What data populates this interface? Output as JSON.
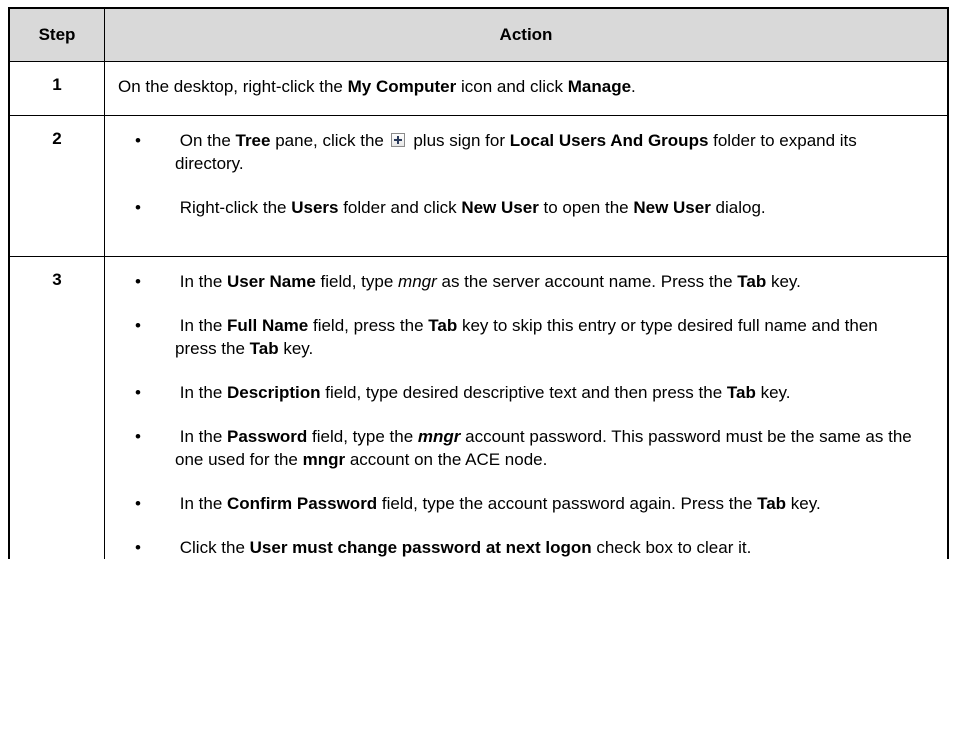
{
  "table": {
    "headers": {
      "step": "Step",
      "action": "Action"
    },
    "row1": {
      "step": "1",
      "t1": "On the desktop, right-click the ",
      "b1": "My Computer",
      "t2": " icon and click ",
      "b2": "Manage",
      "t3": "."
    },
    "row2": {
      "step": "2",
      "bullet1": {
        "t1": "On the ",
        "b1": "Tree",
        "t2": " pane, click the ",
        "t3": " plus sign for ",
        "b2": "Local Users And Groups",
        "t4": " folder to expand its directory."
      },
      "bullet2": {
        "t1": "Right-click the ",
        "b1": "Users",
        "t2": " folder and click ",
        "b2": "New User",
        "t3": " to open the ",
        "b3": "New User",
        "t4": " dialog."
      }
    },
    "row3": {
      "step": "3",
      "bullet1": {
        "t1": "In the ",
        "b1": "User Name",
        "t2": " field, type ",
        "i1": "mngr",
        "t3": " as the server account name. Press the ",
        "b2": "Tab",
        "t4": " key."
      },
      "bullet2": {
        "t1": "In the ",
        "b1": "Full Name",
        "t2": " field, press the ",
        "b2": "Tab",
        "t3": " key to skip this entry or type desired full name and then press the ",
        "b3": "Tab",
        "t4": " key."
      },
      "bullet3": {
        "t1": "In the ",
        "b1": "Description",
        "t2": " field, type desired descriptive text and then press the ",
        "b2": "Tab",
        "t3": " key."
      },
      "bullet4": {
        "t1": "In the ",
        "b1": "Password",
        "t2": " field, type the ",
        "bi1": "mngr",
        "t3": " account password. This password must be the same as the one used for the ",
        "b2": "mngr",
        "t4": " account on the ACE node."
      },
      "bullet5": {
        "t1": "In the ",
        "b1": "Confirm Password",
        "t2": " field, type the account password again. Press the ",
        "b2": "Tab",
        "t3": " key."
      },
      "bullet6": {
        "t1": "Click the ",
        "b1": "User must change password at next logon",
        "t2": " check box to clear it."
      }
    },
    "bullet_char": "•",
    "icons": {
      "plus_icon": "plus-box-icon"
    }
  }
}
